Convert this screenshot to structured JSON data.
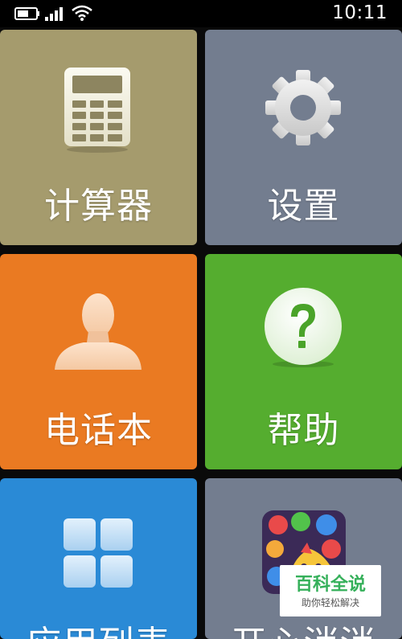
{
  "status_bar": {
    "time": "10:11",
    "icons": [
      "battery-icon",
      "signal-icon",
      "wifi-icon"
    ]
  },
  "tiles": [
    {
      "label": "计算器",
      "icon": "calculator-icon",
      "color": "#a59b6d"
    },
    {
      "label": "设置",
      "icon": "gear-icon",
      "color": "#737d8f"
    },
    {
      "label": "电话本",
      "icon": "contact-person-icon",
      "color": "#ea7a22"
    },
    {
      "label": "帮助",
      "icon": "question-mark-icon",
      "color": "#55ad2f"
    },
    {
      "label": "应用列表",
      "icon": "app-grid-icon",
      "color": "#2a8ad6"
    },
    {
      "label": "开心消消",
      "icon": "game-app-icon",
      "color": "#737d8f"
    }
  ],
  "watermark": {
    "title": "百科全说",
    "subtitle": "助你轻松解决"
  }
}
